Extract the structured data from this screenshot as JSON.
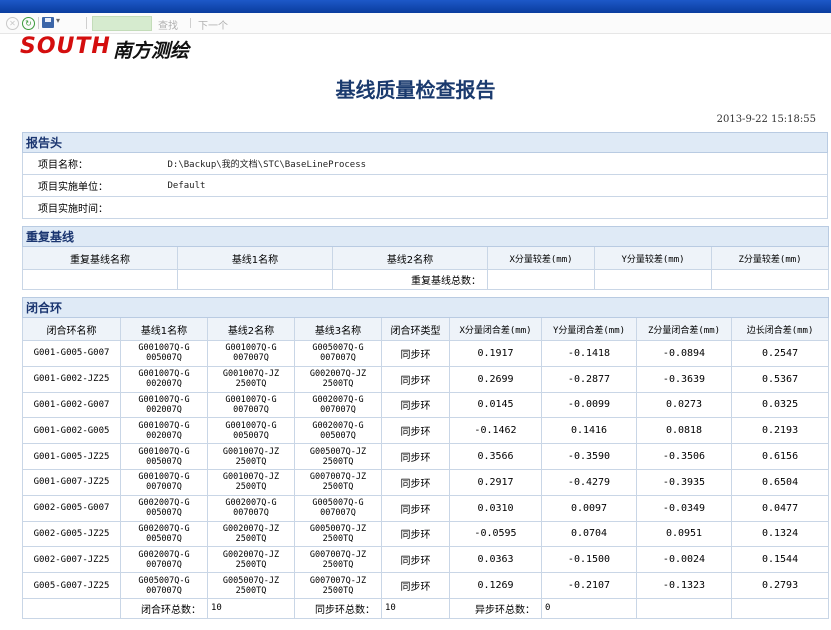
{
  "toolbar": {
    "find_label": "查找",
    "next_label": "下一个"
  },
  "logo": {
    "text": "SOUTH",
    "text_cn": "南方测绘"
  },
  "title": "基线质量检查报告",
  "timestamp": "2013-9-22 15:18:55",
  "header_section": {
    "title": "报告头",
    "fields": [
      {
        "label": "项目名称：",
        "value": "D:\\Backup\\我的文档\\STC\\BaseLineProcess"
      },
      {
        "label": "项目实施单位：",
        "value": "Default"
      },
      {
        "label": "项目实施时间：",
        "value": ""
      }
    ]
  },
  "repeat_section": {
    "title": "重复基线",
    "columns": [
      "重复基线名称",
      "基线1名称",
      "基线2名称",
      "X分量较差(mm)",
      "Y分量较差(mm)",
      "Z分量较差(mm)"
    ],
    "total_label": "重复基线总数：",
    "total_value": ""
  },
  "loop_section": {
    "title": "闭合环",
    "columns": [
      "闭合环名称",
      "基线1名称",
      "基线2名称",
      "基线3名称",
      "闭合环类型",
      "X分量闭合差(mm)",
      "Y分量闭合差(mm)",
      "Z分量闭合差(mm)",
      "边长闭合差(mm)"
    ],
    "rows": [
      {
        "name": "G001-G005-G007",
        "b1": [
          "G001007Q-G",
          "005007Q"
        ],
        "b2": [
          "G001007Q-G",
          "007007Q"
        ],
        "b3": [
          "G005007Q-G",
          "007007Q"
        ],
        "type": "同步环",
        "dx": "0.1917",
        "dy": "-0.1418",
        "dz": "-0.0894",
        "ds": "0.2547"
      },
      {
        "name": "G001-G002-JZ25",
        "b1": [
          "G001007Q-G",
          "002007Q"
        ],
        "b2": [
          "G001007Q-JZ",
          "2500TQ"
        ],
        "b3": [
          "G002007Q-JZ",
          "2500TQ"
        ],
        "type": "同步环",
        "dx": "0.2699",
        "dy": "-0.2877",
        "dz": "-0.3639",
        "ds": "0.5367"
      },
      {
        "name": "G001-G002-G007",
        "b1": [
          "G001007Q-G",
          "002007Q"
        ],
        "b2": [
          "G001007Q-G",
          "007007Q"
        ],
        "b3": [
          "G002007Q-G",
          "007007Q"
        ],
        "type": "同步环",
        "dx": "0.0145",
        "dy": "-0.0099",
        "dz": "0.0273",
        "ds": "0.0325"
      },
      {
        "name": "G001-G002-G005",
        "b1": [
          "G001007Q-G",
          "002007Q"
        ],
        "b2": [
          "G001007Q-G",
          "005007Q"
        ],
        "b3": [
          "G002007Q-G",
          "005007Q"
        ],
        "type": "同步环",
        "dx": "-0.1462",
        "dy": "0.1416",
        "dz": "0.0818",
        "ds": "0.2193"
      },
      {
        "name": "G001-G005-JZ25",
        "b1": [
          "G001007Q-G",
          "005007Q"
        ],
        "b2": [
          "G001007Q-JZ",
          "2500TQ"
        ],
        "b3": [
          "G005007Q-JZ",
          "2500TQ"
        ],
        "type": "同步环",
        "dx": "0.3566",
        "dy": "-0.3590",
        "dz": "-0.3506",
        "ds": "0.6156"
      },
      {
        "name": "G001-G007-JZ25",
        "b1": [
          "G001007Q-G",
          "007007Q"
        ],
        "b2": [
          "G001007Q-JZ",
          "2500TQ"
        ],
        "b3": [
          "G007007Q-JZ",
          "2500TQ"
        ],
        "type": "同步环",
        "dx": "0.2917",
        "dy": "-0.4279",
        "dz": "-0.3935",
        "ds": "0.6504"
      },
      {
        "name": "G002-G005-G007",
        "b1": [
          "G002007Q-G",
          "005007Q"
        ],
        "b2": [
          "G002007Q-G",
          "007007Q"
        ],
        "b3": [
          "G005007Q-G",
          "007007Q"
        ],
        "type": "同步环",
        "dx": "0.0310",
        "dy": "0.0097",
        "dz": "-0.0349",
        "ds": "0.0477"
      },
      {
        "name": "G002-G005-JZ25",
        "b1": [
          "G002007Q-G",
          "005007Q"
        ],
        "b2": [
          "G002007Q-JZ",
          "2500TQ"
        ],
        "b3": [
          "G005007Q-JZ",
          "2500TQ"
        ],
        "type": "同步环",
        "dx": "-0.0595",
        "dy": "0.0704",
        "dz": "0.0951",
        "ds": "0.1324"
      },
      {
        "name": "G002-G007-JZ25",
        "b1": [
          "G002007Q-G",
          "007007Q"
        ],
        "b2": [
          "G002007Q-JZ",
          "2500TQ"
        ],
        "b3": [
          "G007007Q-JZ",
          "2500TQ"
        ],
        "type": "同步环",
        "dx": "0.0363",
        "dy": "-0.1500",
        "dz": "-0.0024",
        "ds": "0.1544"
      },
      {
        "name": "G005-G007-JZ25",
        "b1": [
          "G005007Q-G",
          "007007Q"
        ],
        "b2": [
          "G005007Q-JZ",
          "2500TQ"
        ],
        "b3": [
          "G007007Q-JZ",
          "2500TQ"
        ],
        "type": "同步环",
        "dx": "0.1269",
        "dy": "-0.2107",
        "dz": "-0.1323",
        "ds": "0.2793"
      }
    ],
    "totals": {
      "loop_label": "闭合环总数：",
      "loop_value": "10",
      "sync_label": "同步环总数：",
      "sync_value": "10",
      "async_label": "异步环总数：",
      "async_value": "0"
    }
  }
}
